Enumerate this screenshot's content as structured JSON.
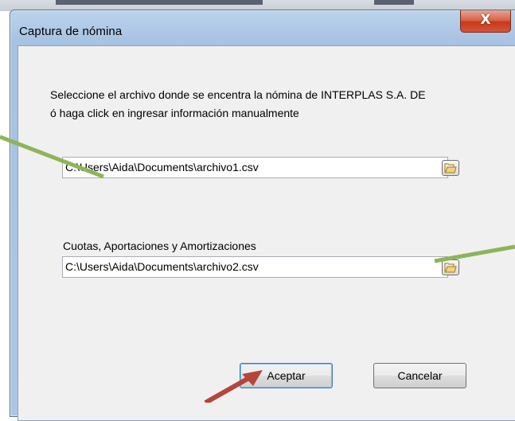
{
  "dialog": {
    "title": "Captura de nómina",
    "close_label": "X",
    "message_line1": "Seleccione el archivo donde se encentra la nómina de INTERPLAS S.A. DE",
    "message_line2": "ó haga click en ingresar información manualmente",
    "file1_value": "C:\\Users\\Aida\\Documents\\archivo1.csv",
    "section2_label": "Cuotas, Aportaciones y Amortizaciones",
    "file2_value": "C:\\Users\\Aida\\Documents\\archivo2.csv",
    "accept_label": "Aceptar",
    "cancel_label": "Cancelar"
  },
  "icons": [
    "close-icon",
    "folder-open-icon",
    "folder-open-icon"
  ],
  "colors": {
    "title_bar": "#a7c2e2",
    "close_button": "#c7391c",
    "annotation_green": "#8db45a",
    "annotation_red": "#b5453c"
  }
}
